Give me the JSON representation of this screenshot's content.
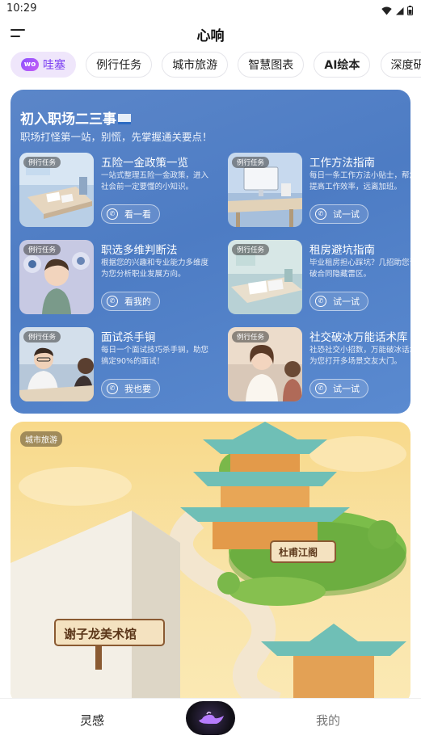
{
  "status": {
    "time": "10:29"
  },
  "header": {
    "title": "心响"
  },
  "tabs": [
    {
      "label": "哇塞",
      "logo": "wo"
    },
    {
      "label": "例行任务"
    },
    {
      "label": "城市旅游"
    },
    {
      "label": "智慧图表"
    },
    {
      "label": "AI绘本"
    },
    {
      "label": "深度研究"
    }
  ],
  "career_card": {
    "title": "初入职场二三事",
    "subtitle": "职场打怪第一站，别慌，先掌握通关要点！",
    "items": [
      {
        "badge": "例行任务",
        "title": "五险一金政策一览",
        "desc": "一站式整理五险一金政策，进入社会前一定要懂的小知识。",
        "button": "看一看"
      },
      {
        "badge": "例行任务",
        "title": "工作方法指南",
        "desc": "每日一条工作方法小贴士，帮您提高工作效率，远离加班。",
        "button": "试一试"
      },
      {
        "badge": "例行任务",
        "title": "职选多维判断法",
        "desc": "根据您的兴趣和专业能力多维度为您分析职业发展方向。",
        "button": "看我的"
      },
      {
        "badge": "例行任务",
        "title": "租房避坑指南",
        "desc": "毕业租房担心踩坑？几招助您识破合同隐藏雷区。",
        "button": "试一试"
      },
      {
        "badge": "例行任务",
        "title": "面试杀手锏",
        "desc": "每日一个面试技巧杀手锏，助您搞定90%的面试！",
        "button": "我也要"
      },
      {
        "badge": "例行任务",
        "title": "社交破冰万能话术库",
        "desc": "社恐社交小招数，万能破冰话术为您打开多场景交友大门。",
        "button": "试一试"
      }
    ]
  },
  "travel_card": {
    "badge": "城市旅游",
    "sign_museum": "谢子龙美术馆",
    "sign_pavilion": "杜甫江阁"
  },
  "bottom_nav": {
    "left": "灵感",
    "right": "我的"
  },
  "colors": {
    "accent": "#7b3ff2",
    "card_blue": "#4d7cc4",
    "card_yellow": "#f9e3a6"
  }
}
